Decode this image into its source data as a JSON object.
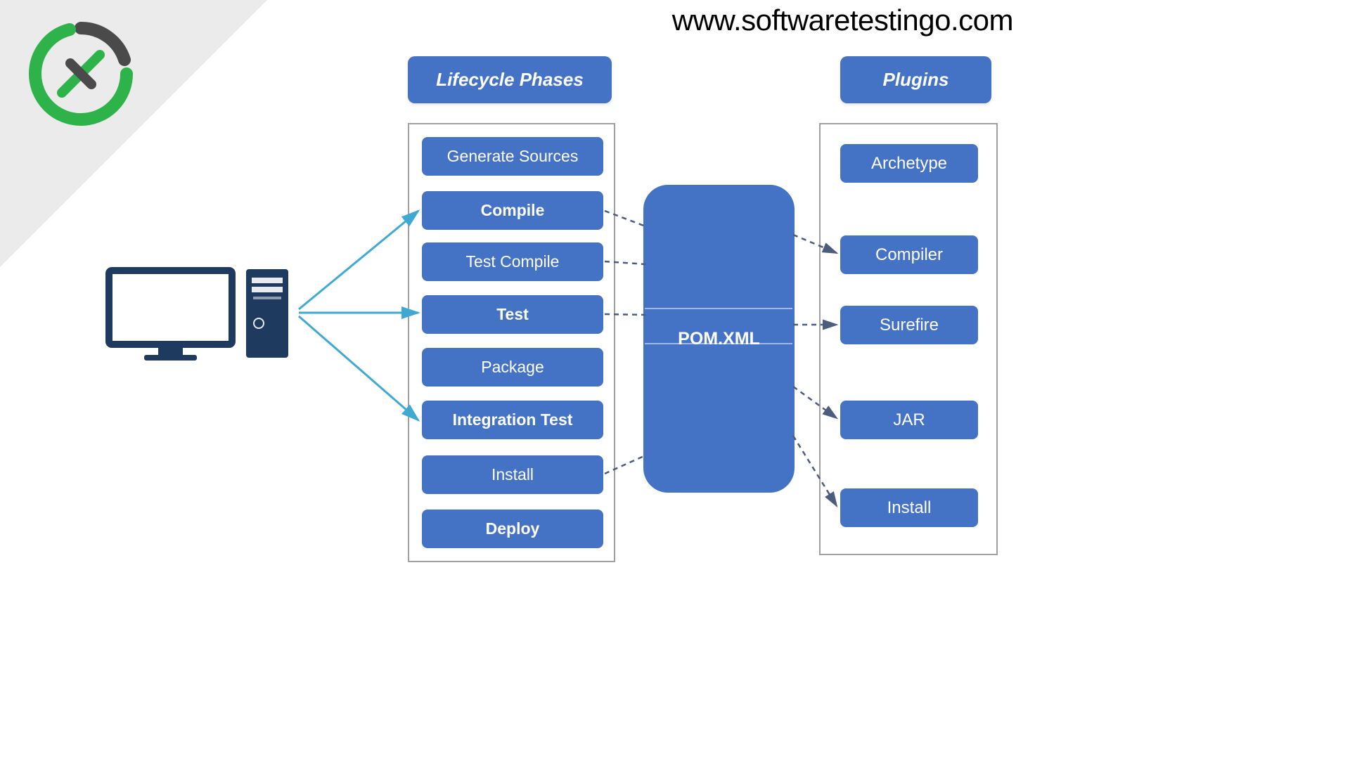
{
  "url": "www.softwaretestingo.com",
  "headers": {
    "lifecycle": "Lifecycle Phases",
    "plugins": "Plugins"
  },
  "pom": "POM.XML",
  "lifecycle_phases": {
    "generate_sources": "Generate Sources",
    "compile": "Compile",
    "test_compile": "Test Compile",
    "test": "Test",
    "package": "Package",
    "integration_test": "Integration Test",
    "install": "Install",
    "deploy": "Deploy"
  },
  "plugins": {
    "archetype": "Archetype",
    "compiler": "Compiler",
    "surefire": "Surefire",
    "jar": "JAR",
    "install": "Install"
  },
  "colors": {
    "primary": "#4472c4",
    "arrow_solid": "#3fa9d4",
    "arrow_dashed": "#4b5c7d",
    "logo_green": "#2db34a",
    "logo_dark": "#4a4a4a",
    "computer_dark": "#1e3a5f"
  }
}
